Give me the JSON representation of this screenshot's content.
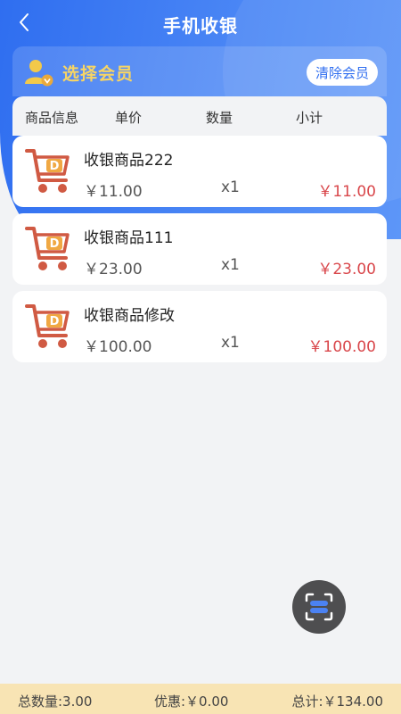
{
  "header": {
    "title": "手机收银"
  },
  "member": {
    "select_label": "选择会员",
    "clear_button": "清除会员"
  },
  "table_header": {
    "col_info": "商品信息",
    "col_price": "单价",
    "col_qty": "数量",
    "col_subtotal": "小计"
  },
  "items": [
    {
      "name": "收银商品222",
      "price": "￥11.00",
      "qty": "x1",
      "subtotal": "￥11.00"
    },
    {
      "name": "收银商品111",
      "price": "￥23.00",
      "qty": "x1",
      "subtotal": "￥23.00"
    },
    {
      "name": "收银商品修改",
      "price": "￥100.00",
      "qty": "x1",
      "subtotal": "￥100.00"
    }
  ],
  "footer": {
    "total_qty": "总数量:3.00",
    "discount": "优惠:￥0.00",
    "total": "总计:￥134.00"
  },
  "colors": {
    "primary": "#2f6ef0",
    "accent_yellow": "#f7d564",
    "price_red": "#d9474b",
    "footer_bg": "#f8e4b4"
  }
}
